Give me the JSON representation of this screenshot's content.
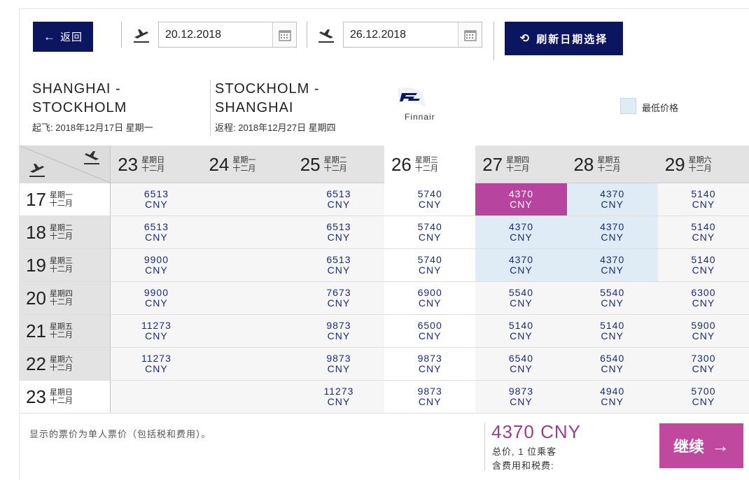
{
  "toolbar": {
    "back_label": "返回",
    "back_icon": "arrow-left-icon",
    "depart_date": "20.12.2018",
    "return_date": "26.12.2018",
    "refresh_label": "刷新日期选择",
    "refresh_icon": "refresh-icon"
  },
  "route": {
    "outbound_line1": "SHANGHAI -",
    "outbound_line2": "STOCKHOLM",
    "outbound_sub": "起飞: 2018年12月17日 星期一",
    "inbound_line1": "STOCKHOLM -",
    "inbound_line2": "SHANGHAI",
    "inbound_sub": "返程: 2018年12月27日 星期四",
    "airline": "Finnair",
    "legend_label": "最低价格"
  },
  "colors": {
    "navy": "#0b1560",
    "selected": "#b7449e",
    "lowest": "#dfecf5",
    "price_text": "#1a2a78"
  },
  "grid": {
    "currency": "CNY",
    "columns": [
      {
        "day": "23",
        "weekday": "星期日",
        "month": "十二月"
      },
      {
        "day": "24",
        "weekday": "星期一",
        "month": "十二月"
      },
      {
        "day": "25",
        "weekday": "星期二",
        "month": "十二月"
      },
      {
        "day": "26",
        "weekday": "星期三",
        "month": "十二月"
      },
      {
        "day": "27",
        "weekday": "星期四",
        "month": "十二月"
      },
      {
        "day": "28",
        "weekday": "星期五",
        "month": "十二月"
      },
      {
        "day": "29",
        "weekday": "星期六",
        "month": "十二月"
      }
    ],
    "rows": [
      {
        "day": "17",
        "weekday": "星期一",
        "month": "十二月",
        "prices": [
          "6513",
          "",
          "6513",
          "5740",
          "4370",
          "4370",
          "5140"
        ]
      },
      {
        "day": "18",
        "weekday": "星期二",
        "month": "十二月",
        "prices": [
          "6513",
          "",
          "6513",
          "5740",
          "4370",
          "4370",
          "5140"
        ]
      },
      {
        "day": "19",
        "weekday": "星期三",
        "month": "十二月",
        "prices": [
          "9900",
          "",
          "6513",
          "5740",
          "4370",
          "4370",
          "5140"
        ]
      },
      {
        "day": "20",
        "weekday": "星期四",
        "month": "十二月",
        "prices": [
          "9900",
          "",
          "7673",
          "6900",
          "5540",
          "5540",
          "6300"
        ]
      },
      {
        "day": "21",
        "weekday": "星期五",
        "month": "十二月",
        "prices": [
          "11273",
          "",
          "9873",
          "6500",
          "5140",
          "5140",
          "5900"
        ]
      },
      {
        "day": "22",
        "weekday": "星期六",
        "month": "十二月",
        "prices": [
          "11273",
          "",
          "9873",
          "9873",
          "6540",
          "6540",
          "7300"
        ]
      },
      {
        "day": "23",
        "weekday": "星期日",
        "month": "十二月",
        "prices": [
          "",
          "",
          "11273",
          "9873",
          "9873",
          "4940",
          "5700"
        ]
      }
    ],
    "selected_column": 3,
    "selected_row": 0,
    "selected_cell": {
      "row": 0,
      "col": 4
    },
    "lowest_cells": [
      [
        0,
        5
      ],
      [
        1,
        4
      ],
      [
        1,
        5
      ],
      [
        2,
        4
      ],
      [
        2,
        5
      ]
    ],
    "whiter_rows": [
      0,
      6
    ]
  },
  "footer": {
    "note": "显示的票价为单人票价（包括税和费用）。",
    "total": "4370 CNY",
    "total_sub1": "总价, 1 位乘客",
    "total_sub2": "含费用和税费:",
    "continue_label": "继续"
  }
}
